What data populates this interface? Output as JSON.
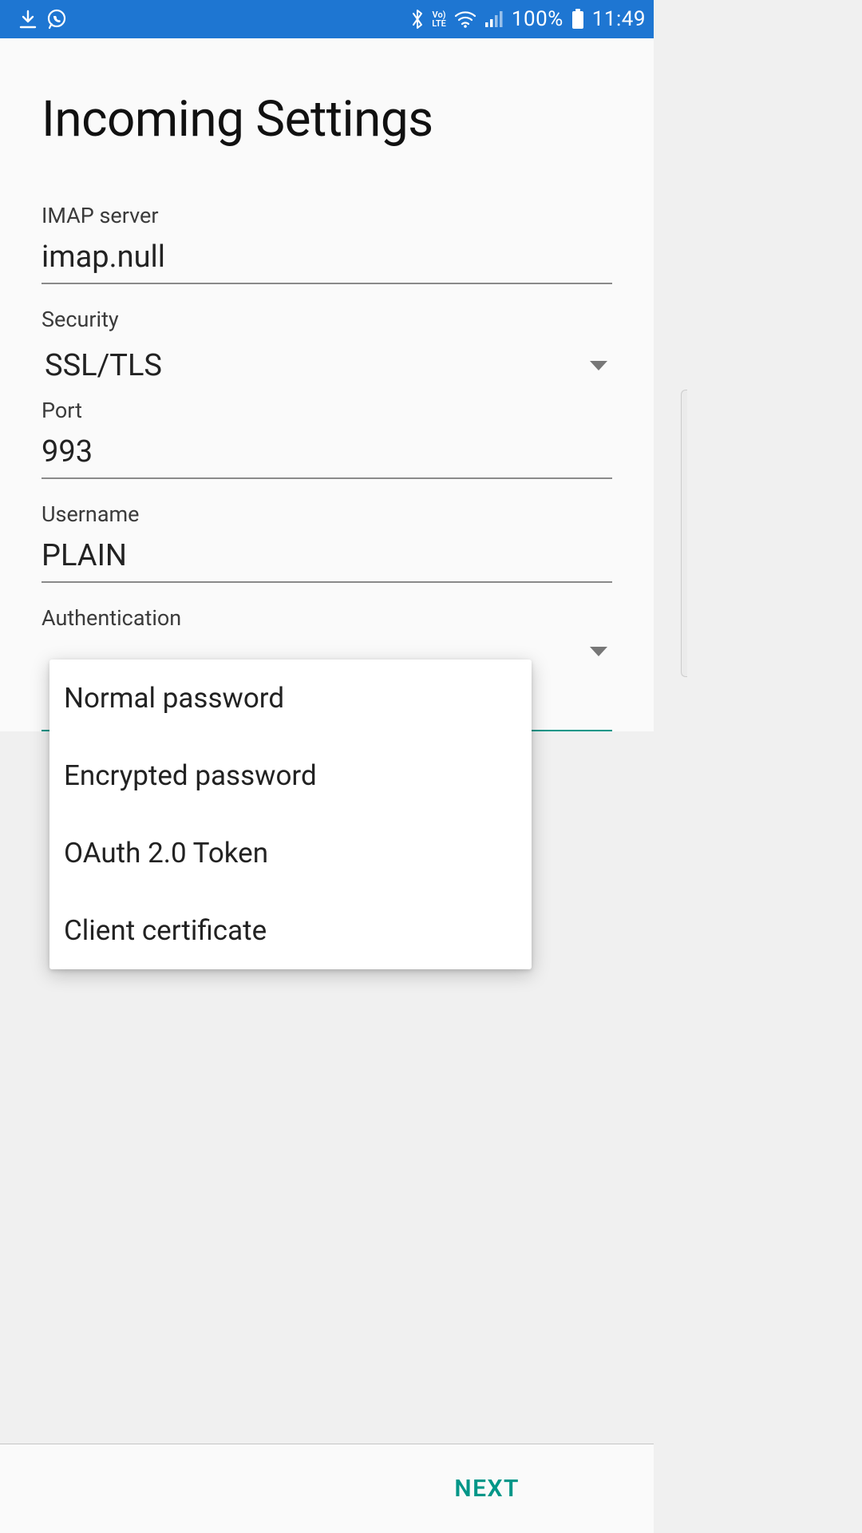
{
  "status_bar": {
    "battery_pct": "100%",
    "time": "11:49",
    "lte_line1": "Vo)",
    "lte_line2": "LTE"
  },
  "page": {
    "title": "Incoming Settings",
    "fields": {
      "imap_server": {
        "label": "IMAP server",
        "value": "imap.null"
      },
      "security": {
        "label": "Security",
        "value": "SSL/TLS"
      },
      "port": {
        "label": "Port",
        "value": "993"
      },
      "username": {
        "label": "Username",
        "value": "PLAIN"
      },
      "authentication": {
        "label": "Authentication"
      }
    },
    "auth_dropdown": {
      "options": [
        "Normal password",
        "Encrypted password",
        "OAuth 2.0 Token",
        "Client certificate"
      ]
    },
    "next_label": "NEXT"
  }
}
